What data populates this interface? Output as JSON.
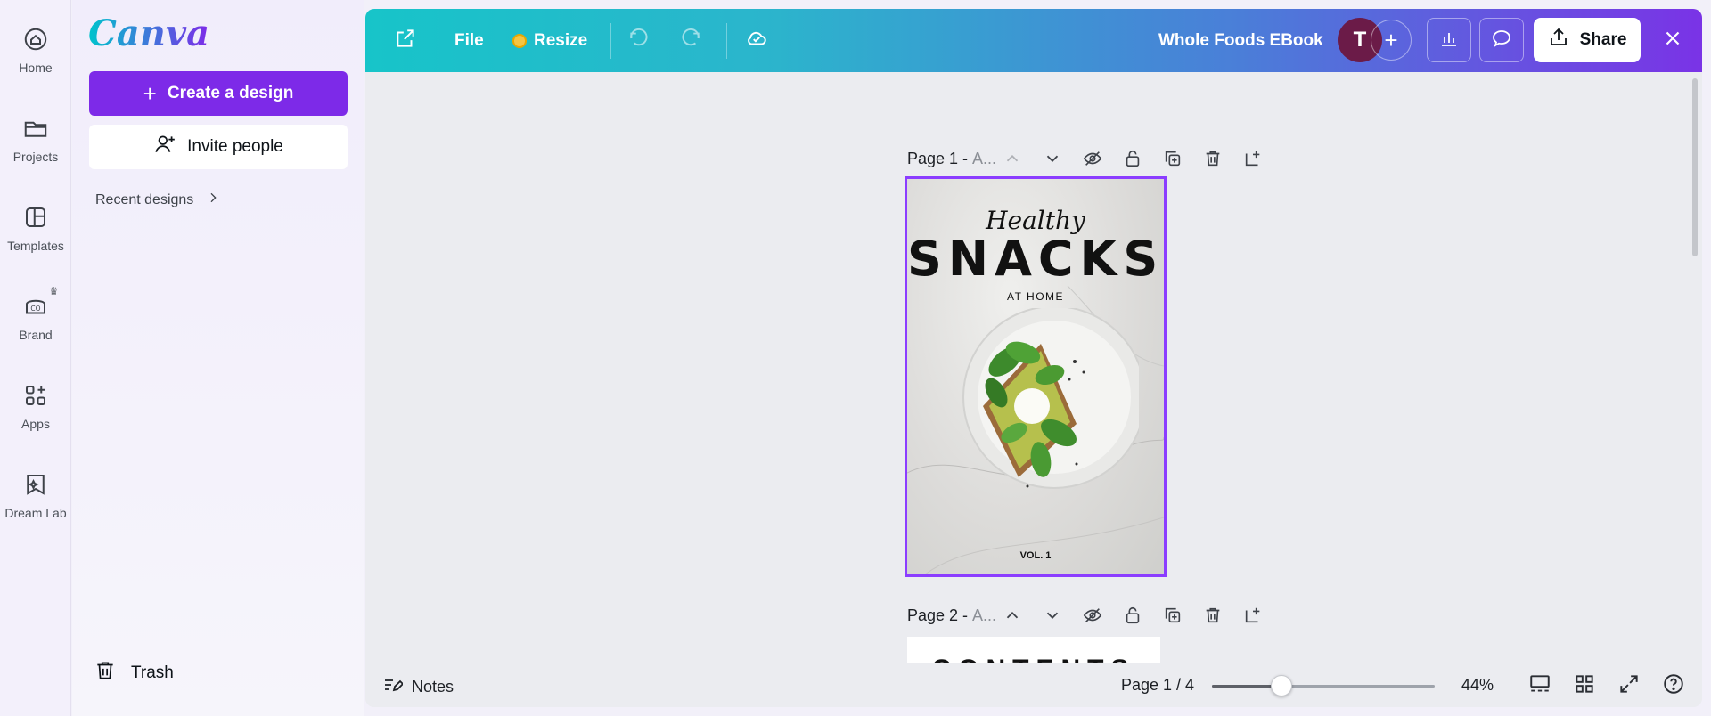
{
  "rail": {
    "items": [
      {
        "label": "Home"
      },
      {
        "label": "Projects"
      },
      {
        "label": "Templates"
      },
      {
        "label": "Brand"
      },
      {
        "label": "Apps"
      },
      {
        "label": "Dream Lab"
      }
    ]
  },
  "panel": {
    "logo": "Canva",
    "create_label": "Create a design",
    "invite_label": "Invite people",
    "recent_label": "Recent designs",
    "trash_label": "Trash"
  },
  "topbar": {
    "file_label": "File",
    "resize_label": "Resize",
    "doc_title": "Whole Foods EBook",
    "avatar_initial": "T",
    "share_label": "Share",
    "gradient_start": "#17c4c9",
    "gradient_end": "#7a33e6"
  },
  "canvas": {
    "page1_title": "Page 1 - ",
    "page1_subtitle": "A...",
    "page2_title": "Page 2 - ",
    "page2_subtitle": "A...",
    "cover": {
      "script_text": "Healthy",
      "headline": "SNACKS",
      "tagline": "AT HOME",
      "volume": "VOL. 1"
    },
    "page2_heading": "CONTENTS",
    "selection_color": "#8b3dff"
  },
  "bottombar": {
    "notes_label": "Notes",
    "page_indicator": "Page 1 / 4",
    "zoom_label": "44%",
    "zoom_fraction": 0.31
  },
  "accent": "#7d2ae8"
}
